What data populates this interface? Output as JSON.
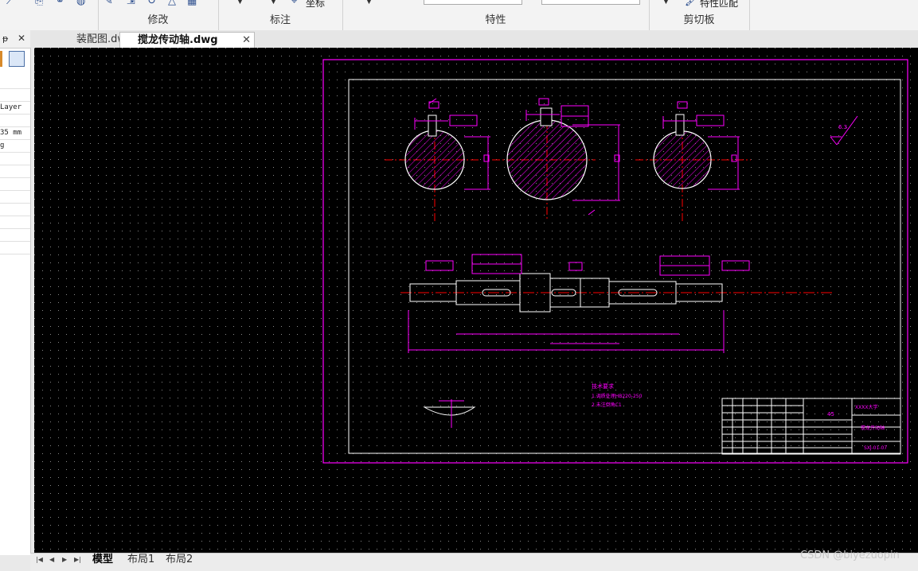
{
  "ribbon": {
    "groups": {
      "modify": {
        "label": "修改"
      },
      "annotate": {
        "label": "标注",
        "coord_text": "坐标"
      },
      "properties": {
        "label": "特性"
      },
      "clipboard": {
        "label": "剪切板",
        "match_text": "特性匹配"
      }
    }
  },
  "panel": {
    "pin": "ᵽ",
    "close": "✕",
    "rows": [
      "",
      "",
      "Layer",
      "",
      "35 mm",
      "g",
      "",
      "",
      "",
      "",
      "",
      "",
      "",
      ""
    ]
  },
  "tabs": [
    {
      "label": "装配图.dwg"
    },
    {
      "label": "搅龙传动轴.dwg",
      "close": "✕"
    }
  ],
  "layouts": [
    {
      "label": "模型"
    },
    {
      "label": "布局1"
    },
    {
      "label": "布局2"
    }
  ],
  "drawing": {
    "notes_title": "技术要求",
    "notes_line1": "1.调质处理HB220-250",
    "notes_line2": "2.未注倒角C1",
    "title_block": {
      "part_name": "搅龙传动轴",
      "drawing_no": "SXJ-01-07",
      "school": "XXXX大学",
      "material": "45"
    },
    "roughness": "6.3"
  },
  "watermark": "CSDN @biyezuopin",
  "colors": {
    "canvas": "#000000",
    "frame": "#ff00ff",
    "geometry": "#ffffff",
    "centerline": "#ff0000",
    "grid": "#888888"
  }
}
